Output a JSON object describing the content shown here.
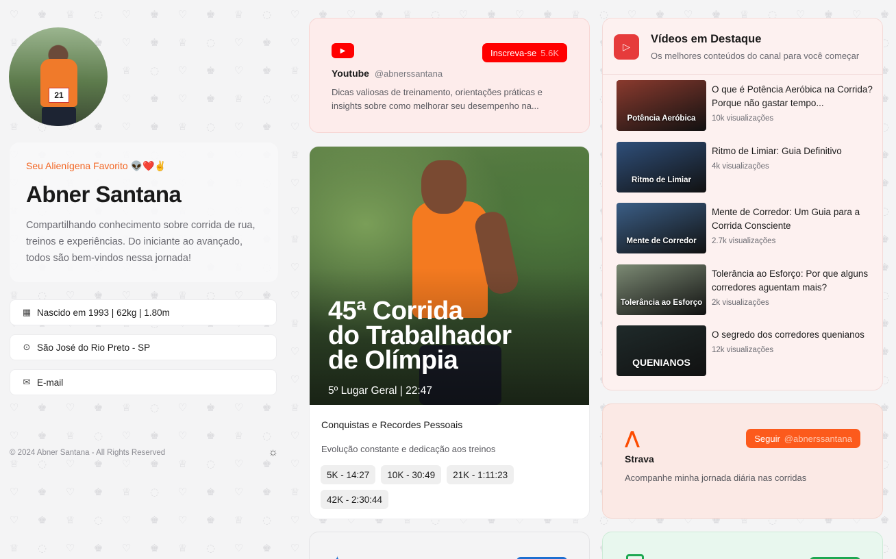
{
  "profile": {
    "tagline": "Seu Alienígena Favorito 👽❤️✌️",
    "name": "Abner Santana",
    "bio": "Compartilhando conhecimento sobre corrida de rua, treinos e experiências. Do iniciante ao avançado, todos são bem-vindos nessa jornada!",
    "avatar_bib": "21"
  },
  "info": {
    "birth": "Nascido em 1993 | 62kg | 1.80m",
    "location": "São José do Rio Preto - SP",
    "email": "E-mail"
  },
  "footer": {
    "copyright": "© 2024 Abner Santana - All Rights Reserved"
  },
  "youtube": {
    "subscribe_label": "Inscreva-se",
    "subscribers": "5.6K",
    "title": "Youtube",
    "handle": "@abnerssantana",
    "description": "Dicas valiosas de treinamento, orientações práticas e insights sobre como melhorar seu desempenho na..."
  },
  "race": {
    "headline_1": "45ª Corrida",
    "headline_2": "do Trabalhador",
    "headline_3": "de Olímpia",
    "result": "5º Lugar Geral | 22:47",
    "achievements_title": "Conquistas e Recordes Pessoais",
    "achievements_sub": "Evolução constante e dedicação aos treinos",
    "records": [
      "5K - 14:27",
      "10K - 30:49",
      "21K - 1:11:23",
      "42K - 2:30:44"
    ]
  },
  "featured": {
    "title": "Vídeos em Destaque",
    "subtitle": "Os melhores conteúdos do canal para você começar",
    "videos": [
      {
        "title": "O que é Potência Aeróbica na Corrida? Porque não gastar tempo...",
        "views": "10k visualizações",
        "thumb": "Potência Aeróbica",
        "color": "#8a3a2e"
      },
      {
        "title": "Ritmo de Limiar: Guia Definitivo",
        "views": "4k visualizações",
        "thumb": "Ritmo de Limiar",
        "color": "#2f4f7a"
      },
      {
        "title": "Mente de Corredor: Um Guia para a Corrida Consciente",
        "views": "2.7k visualizações",
        "thumb": "Mente de Corredor",
        "color": "#3b5e86"
      },
      {
        "title": "Tolerância ao Esforço: Por que alguns corredores aguentam mais?",
        "views": "2k visualizações",
        "thumb": "Tolerância ao Esforço",
        "color": "#7c8a74"
      },
      {
        "title": "O segredo dos corredores quenianos",
        "views": "12k visualizações",
        "thumb": "QUENIANOS",
        "color": "#1f2a2a"
      }
    ]
  },
  "strava": {
    "follow_label": "Seguir",
    "handle": "@abnerssantana",
    "title": "Strava",
    "description": "Acompanhe minha jornada diária nas corridas"
  }
}
